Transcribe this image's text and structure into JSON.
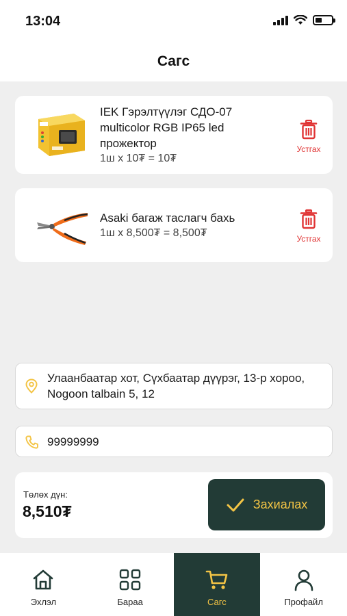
{
  "status_bar": {
    "time": "13:04"
  },
  "header": {
    "title": "Сагс"
  },
  "cart": {
    "items": [
      {
        "name": "IEK Гэрэлтүүлэг СДО-07 multicolor RGB IP65 led прожектор",
        "quantity": "1ш x 10₮ = 10₮",
        "thumb_icon": "floodlight-product-image",
        "remove_label": "Устгах"
      },
      {
        "name": "Asaki багаж таслагч бахь",
        "quantity": "1ш x 8,500₮ = 8,500₮",
        "thumb_icon": "pliers-product-image",
        "remove_label": "Устгах"
      }
    ]
  },
  "address": {
    "value": "Улаанбаатар хот, Сүхбаатар дүүрэг, 13-р хороо, Nogoon talbain 5, 12",
    "icon": "location-pin-icon"
  },
  "phone": {
    "value": "99999999",
    "icon": "phone-icon"
  },
  "total": {
    "label": "Төлөх дүн:",
    "value": "8,510₮"
  },
  "order_button": {
    "label": "Захиалах",
    "icon": "checkmark-icon"
  },
  "bottom_nav": {
    "items": [
      {
        "label": "Эхлэл",
        "icon": "home-icon",
        "active": false
      },
      {
        "label": "Бараа",
        "icon": "grid-icon",
        "active": false
      },
      {
        "label": "Сагс",
        "icon": "cart-icon",
        "active": true
      },
      {
        "label": "Профайл",
        "icon": "user-icon",
        "active": false
      }
    ]
  },
  "colors": {
    "accent": "#f3c445",
    "dark": "#223b36",
    "danger": "#e03434",
    "background": "#efefef"
  }
}
